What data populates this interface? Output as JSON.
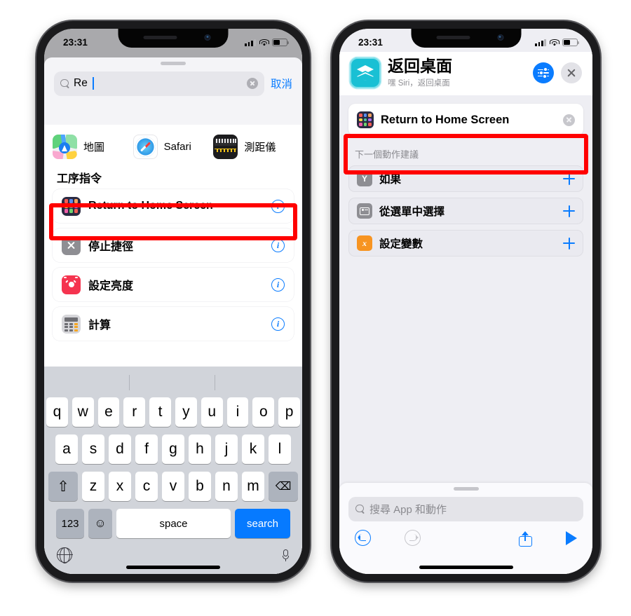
{
  "left_phone": {
    "status": {
      "time": "23:31"
    },
    "search": {
      "value": "Re",
      "placeholder": "",
      "cancel_label": "取消"
    },
    "apps_row": [
      {
        "name": "地圖",
        "icon": "maps-icon"
      },
      {
        "name": "Safari",
        "icon": "safari-icon"
      },
      {
        "name": "測距儀",
        "icon": "measure-icon"
      }
    ],
    "section_header": "工序指令",
    "results": [
      {
        "label": "Return to Home Screen",
        "icon": "app-grid-icon",
        "accessory": "info-icon",
        "highlighted": true
      },
      {
        "label": "停止捷徑",
        "icon": "x-mark-icon",
        "accessory": "info-icon",
        "highlighted": false
      },
      {
        "label": "設定亮度",
        "icon": "brightness-sun-icon",
        "accessory": "info-icon",
        "highlighted": false
      },
      {
        "label": "計算",
        "icon": "calculator-icon",
        "accessory": "info-icon",
        "highlighted": false
      }
    ],
    "keyboard": {
      "row1": [
        "q",
        "w",
        "e",
        "r",
        "t",
        "y",
        "u",
        "i",
        "o",
        "p"
      ],
      "row2": [
        "a",
        "s",
        "d",
        "f",
        "g",
        "h",
        "j",
        "k",
        "l"
      ],
      "row3": [
        "z",
        "x",
        "c",
        "v",
        "b",
        "n",
        "m"
      ],
      "shift_label": "⇧",
      "backspace_label": "⌫",
      "numbers_label": "123",
      "emoji_label": "☺",
      "space_label": "space",
      "return_label": "search"
    }
  },
  "right_phone": {
    "status": {
      "time": "23:31"
    },
    "shortcut": {
      "title": "返回桌面",
      "subtitle": "嘿 Siri，返回桌面",
      "settings_button": "sliders-icon",
      "close_button": "close-icon"
    },
    "action": {
      "label": "Return to Home Screen",
      "icon": "app-grid-icon",
      "remove": "remove-icon",
      "highlighted": true
    },
    "suggestions_header": "下一個動作建議",
    "suggestions": [
      {
        "label": "如果",
        "icon": "branch-icon",
        "add": "plus-icon"
      },
      {
        "label": "從選單中選擇",
        "icon": "menu-icon",
        "add": "plus-icon"
      },
      {
        "label": "設定變數",
        "icon": "variable-icon",
        "add": "plus-icon"
      }
    ],
    "bottom": {
      "search_placeholder": "搜尋 App 和動作",
      "tools": [
        {
          "name": "undo-button",
          "state": "enabled"
        },
        {
          "name": "redo-button",
          "state": "disabled"
        },
        {
          "name": "share-button",
          "state": "enabled"
        },
        {
          "name": "run-button",
          "state": "enabled"
        }
      ]
    }
  },
  "colors": {
    "accent_blue": "#0a7cff",
    "highlight_red": "#ff0000",
    "shortcut_teal": "#19c0d4",
    "orange": "#f79421",
    "red_icon": "#f5344f"
  }
}
